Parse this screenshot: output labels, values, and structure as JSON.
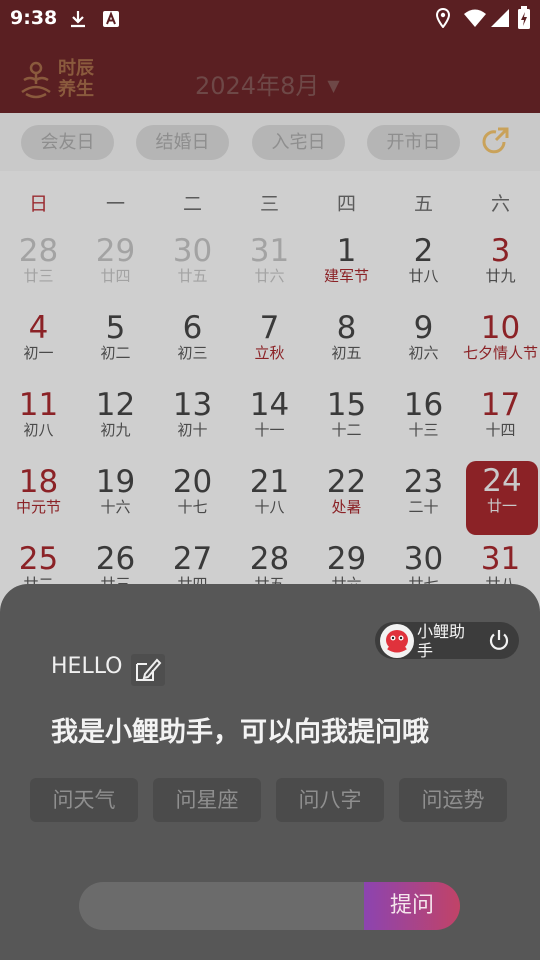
{
  "status_bar": {
    "time": "9:38",
    "icons": [
      "download-icon",
      "font-icon",
      "location-icon",
      "wifi-icon",
      "signal-icon",
      "battery-icon"
    ]
  },
  "header": {
    "logo_text_line1": "时辰",
    "logo_text_line2": "养生",
    "month_title": "2024年8月",
    "dropdown_caret": "▼",
    "bg_color": "#5a1f22"
  },
  "filter_chips": [
    "会友日",
    "结婚日",
    "入宅日",
    "开市日"
  ],
  "calendar": {
    "weekdays": [
      "日",
      "一",
      "二",
      "三",
      "四",
      "五",
      "六"
    ],
    "today": "24",
    "accent_color": "#8b2226",
    "days": [
      {
        "num": "28",
        "lunar": "廿三",
        "other_month": true,
        "weekend": true
      },
      {
        "num": "29",
        "lunar": "廿四",
        "other_month": true
      },
      {
        "num": "30",
        "lunar": "廿五",
        "other_month": true
      },
      {
        "num": "31",
        "lunar": "廿六",
        "other_month": true
      },
      {
        "num": "1",
        "lunar": "建军节",
        "festival": true
      },
      {
        "num": "2",
        "lunar": "廿八"
      },
      {
        "num": "3",
        "lunar": "廿九",
        "weekend": true
      },
      {
        "num": "4",
        "lunar": "初一",
        "weekend": true
      },
      {
        "num": "5",
        "lunar": "初二"
      },
      {
        "num": "6",
        "lunar": "初三"
      },
      {
        "num": "7",
        "lunar": "立秋",
        "festival": true
      },
      {
        "num": "8",
        "lunar": "初五"
      },
      {
        "num": "9",
        "lunar": "初六"
      },
      {
        "num": "10",
        "lunar": "七夕情人节",
        "weekend": true,
        "festival": true
      },
      {
        "num": "11",
        "lunar": "初八",
        "weekend": true
      },
      {
        "num": "12",
        "lunar": "初九"
      },
      {
        "num": "13",
        "lunar": "初十"
      },
      {
        "num": "14",
        "lunar": "十一"
      },
      {
        "num": "15",
        "lunar": "十二"
      },
      {
        "num": "16",
        "lunar": "十三"
      },
      {
        "num": "17",
        "lunar": "十四",
        "weekend": true
      },
      {
        "num": "18",
        "lunar": "中元节",
        "weekend": true,
        "festival": true
      },
      {
        "num": "19",
        "lunar": "十六"
      },
      {
        "num": "20",
        "lunar": "十七"
      },
      {
        "num": "21",
        "lunar": "十八"
      },
      {
        "num": "22",
        "lunar": "处暑",
        "festival": true
      },
      {
        "num": "23",
        "lunar": "二十"
      },
      {
        "num": "24",
        "lunar": "廿一",
        "weekend": true,
        "today": true
      },
      {
        "num": "25",
        "lunar": "廿二",
        "weekend": true
      },
      {
        "num": "26",
        "lunar": "廿三"
      },
      {
        "num": "27",
        "lunar": "廿四"
      },
      {
        "num": "28",
        "lunar": "廿五"
      },
      {
        "num": "29",
        "lunar": "廿六"
      },
      {
        "num": "30",
        "lunar": "廿七"
      },
      {
        "num": "31",
        "lunar": "廿八",
        "weekend": true
      }
    ]
  },
  "assistant": {
    "toggle_label": "小鲤助手",
    "greeting": "HELLO",
    "intro": "我是小鲤助手，可以向我提问哦",
    "quick_questions": [
      "问天气",
      "问星座",
      "问八字",
      "问运势"
    ],
    "input_placeholder": "",
    "ask_label": "提问",
    "ask_gradient": [
      "#8c44b0",
      "#c14367"
    ]
  }
}
